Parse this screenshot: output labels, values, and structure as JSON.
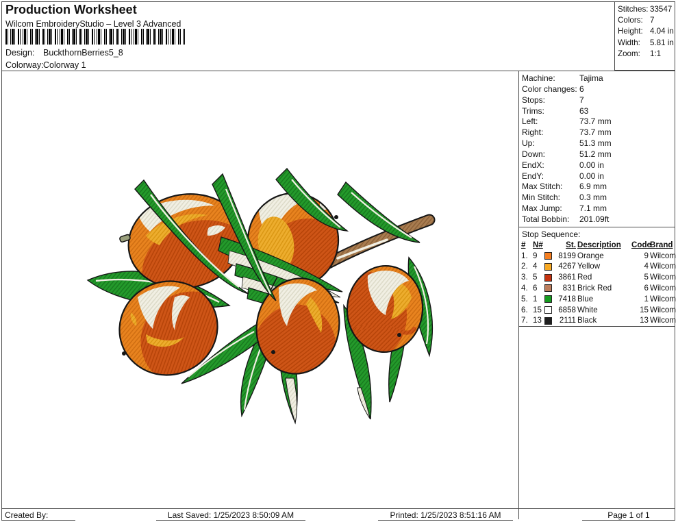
{
  "header": {
    "title": "Production Worksheet",
    "subtitle": "Wilcom EmbroideryStudio – Level 3 Advanced",
    "design_label": "Design:",
    "design_value": "BuckthornBerries5_8",
    "colorway_label": "Colorway:",
    "colorway_value": "Colorway 1",
    "barcode_icon": "barcode"
  },
  "summary": {
    "rows": [
      {
        "label": "Stitches:",
        "value": "33547"
      },
      {
        "label": "Colors:",
        "value": "7"
      },
      {
        "label": "Height:",
        "value": "4.04 in"
      },
      {
        "label": "Width:",
        "value": "5.81 in"
      },
      {
        "label": "Zoom:",
        "value": "1:1"
      }
    ]
  },
  "machine_info": {
    "rows": [
      {
        "label": "Machine:",
        "value": "Tajima"
      },
      {
        "label": "Color changes:",
        "value": "6"
      },
      {
        "label": "Stops:",
        "value": "7"
      },
      {
        "label": "Trims:",
        "value": "63"
      },
      {
        "label": "Left:",
        "value": "73.7 mm"
      },
      {
        "label": "Right:",
        "value": "73.7 mm"
      },
      {
        "label": "Up:",
        "value": "51.3 mm"
      },
      {
        "label": "Down:",
        "value": "51.2 mm"
      },
      {
        "label": "EndX:",
        "value": "0.00 in"
      },
      {
        "label": "EndY:",
        "value": "0.00 in"
      },
      {
        "label": "Max Stitch:",
        "value": "6.9 mm"
      },
      {
        "label": "Min Stitch:",
        "value": "0.3 mm"
      },
      {
        "label": "Max Jump:",
        "value": "7.1 mm"
      },
      {
        "label": "Total Bobbin:",
        "value": "201.09ft"
      }
    ]
  },
  "stop_sequence": {
    "title": "Stop Sequence:",
    "columns": [
      "#",
      "N#",
      "St.",
      "Description",
      "Code",
      "Brand"
    ],
    "rows": [
      {
        "num": "1.",
        "n": "9",
        "color": "#F57E20",
        "st": "8199",
        "desc": "Orange",
        "code": "9",
        "brand": "Wilcom"
      },
      {
        "num": "2.",
        "n": "4",
        "color": "#F7A823",
        "st": "4267",
        "desc": "Yellow",
        "code": "4",
        "brand": "Wilcom"
      },
      {
        "num": "3.",
        "n": "5",
        "color": "#C53310",
        "st": "3861",
        "desc": "Red",
        "code": "5",
        "brand": "Wilcom"
      },
      {
        "num": "4.",
        "n": "6",
        "color": "#BC7D5C",
        "st": "831",
        "desc": "Brick Red",
        "code": "6",
        "brand": "Wilcom"
      },
      {
        "num": "5.",
        "n": "1",
        "color": "#169B1F",
        "st": "7418",
        "desc": "Blue",
        "code": "1",
        "brand": "Wilcom"
      },
      {
        "num": "6.",
        "n": "15",
        "color": "#FFFFFF",
        "st": "6858",
        "desc": "White",
        "code": "15",
        "brand": "Wilcom"
      },
      {
        "num": "7.",
        "n": "13",
        "color": "#1E1E1E",
        "st": "2111",
        "desc": "Black",
        "code": "13",
        "brand": "Wilcom"
      }
    ]
  },
  "footer": {
    "created_by": "Created By:",
    "last_saved": "Last Saved: 1/25/2023 8:50:09 AM",
    "printed": "Printed: 1/25/2023 8:51:16 AM",
    "page": "Page 1 of 1"
  },
  "artwork": {
    "name": "buckthorn-berries-embroidery-preview",
    "palette": {
      "orange": "#E8831F",
      "dark_orange": "#CE5517",
      "yellow": "#EDAD2E",
      "green": "#249A2B",
      "cream": "#F1EFE3",
      "brown": "#A87C50",
      "outline": "#161616"
    }
  }
}
